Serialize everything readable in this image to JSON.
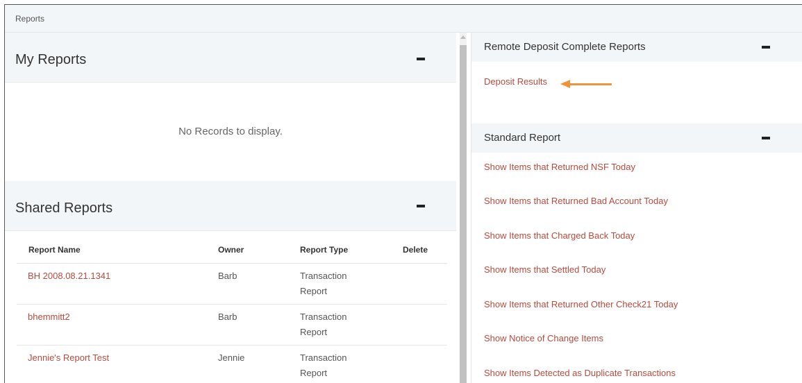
{
  "breadcrumb": "Reports",
  "my_reports": {
    "title": "My Reports",
    "empty_message": "No Records to display."
  },
  "shared_reports": {
    "title": "Shared Reports",
    "columns": [
      "Report Name",
      "Owner",
      "Report Type",
      "Delete"
    ],
    "rows": [
      {
        "name": "BH 2008.08.21.1341",
        "owner": "Barb",
        "type_line1": "Transaction",
        "type_line2": "Report"
      },
      {
        "name": "bhemmitt2",
        "owner": "Barb",
        "type_line1": "Transaction",
        "type_line2": "Report"
      },
      {
        "name": "Jennie's Report Test",
        "owner": "Jennie",
        "type_line1": "Transaction",
        "type_line2": "Report"
      }
    ]
  },
  "remote_deposit": {
    "title": "Remote Deposit Complete Reports",
    "links": [
      "Deposit Results"
    ]
  },
  "standard_report": {
    "title": "Standard Report",
    "links": [
      "Show Items that Returned NSF Today",
      "Show Items that Returned Bad Account Today",
      "Show Items that Charged Back Today",
      "Show Items that Settled Today",
      "Show Items that Returned Other Check21 Today",
      "Show Notice of Change Items",
      "Show Items Detected as Duplicate Transactions"
    ]
  },
  "colors": {
    "link": "#b84a3c",
    "annotation_arrow": "#f0923a",
    "panel_header": "#f3f6f8"
  }
}
